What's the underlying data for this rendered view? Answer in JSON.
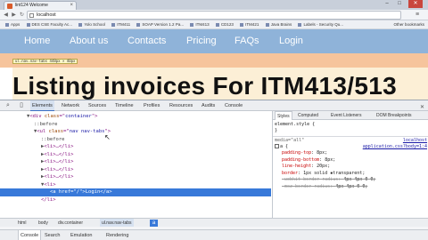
{
  "browser": {
    "tab_title": "lint124 Welcome",
    "tab_close": "×",
    "win_min": "–",
    "win_max": "□",
    "win_close": "✕",
    "back": "◀",
    "forward": "▶",
    "reload": "↻",
    "url": "localhost",
    "menu": "≡",
    "bookmarks": [
      "Apps",
      "DES CSE Faculty Ac...",
      "Yolo School",
      "ITM411",
      "SOAP Version 1.2 Pa...",
      "ITM413",
      "CD123",
      "ITM421",
      "Java Brains",
      "Labels - Security Qu..."
    ],
    "bookmarks_other": "Other bookmarks"
  },
  "site": {
    "nav": [
      "Home",
      "About us",
      "Contacts",
      "Pricing",
      "FAQs",
      "Login"
    ],
    "tooltip": "ul.nav.nav-tabs 448px × 40px",
    "heading": "Listing invoices For ITM413/513"
  },
  "devtools": {
    "tabs": [
      "Elements",
      "Network",
      "Sources",
      "Timeline",
      "Profiles",
      "Resources",
      "Audits",
      "Console"
    ],
    "close": "✕",
    "elements": [
      {
        "indent": 0,
        "tri": "▼",
        "parts": [
          "<div ",
          "class",
          "=\"",
          "container",
          "\">"
        ]
      },
      {
        "indent": 1,
        "tri": "",
        "pseudo": "::before"
      },
      {
        "indent": 1,
        "tri": "▼",
        "parts": [
          "<ul ",
          "class",
          "=\"",
          "nav nav-tabs",
          "\">"
        ]
      },
      {
        "indent": 2,
        "tri": "",
        "pseudo": "::before"
      },
      {
        "indent": 2,
        "tri": "▶",
        "tagtext": "<li>…</li>"
      },
      {
        "indent": 2,
        "tri": "▶",
        "tagtext": "<li>…</li>"
      },
      {
        "indent": 2,
        "tri": "▶",
        "tagtext": "<li>…</li>"
      },
      {
        "indent": 2,
        "tri": "▶",
        "tagtext": "<li>…</li>"
      },
      {
        "indent": 2,
        "tri": "▶",
        "tagtext": "<li>…</li>"
      },
      {
        "indent": 2,
        "tri": "▼",
        "tagtext": "<li>"
      },
      {
        "indent": 3,
        "tri": "",
        "selected": true,
        "tagtext": "<a href=\"/\">Login</a>"
      },
      {
        "indent": 2,
        "tri": "",
        "tagtext": "</li>"
      }
    ],
    "breadcrumbs": [
      "html",
      "body",
      "div.container",
      "ul.nav.nav-tabs"
    ],
    "breadcrumb_arrow": "a",
    "styles_tabs": [
      "Styles",
      "Computed",
      "Event Listeners",
      "DOM Breakpoints"
    ],
    "styles": {
      "element_style": "element.style {",
      "close_brace": "}",
      "media": "media=\"all\"",
      "source_host": "localhost",
      "source_file": "application.css?body=1:4",
      "selector": "a {",
      "props": [
        {
          "name": "padding-top",
          "value": "8px;",
          "strike": false
        },
        {
          "name": "padding-bottom",
          "value": "8px;",
          "strike": false
        },
        {
          "name": "line-height",
          "value": "20px;",
          "strike": false
        },
        {
          "name": "border",
          "value": "1px solid ▪transparent;",
          "strike": false
        },
        {
          "name": "-webkit-border-radius",
          "value": "4px 4px 0 0;",
          "strike": true
        },
        {
          "name": "-moz-border-radius",
          "value": "4px 4px 0 0;",
          "strike": true
        }
      ]
    },
    "bottom_tabs": [
      "Console",
      "Search",
      "Emulation",
      "Rendering"
    ]
  },
  "colors": {
    "navbar": "#8fb3d9",
    "orange_strip": "#f6c49c",
    "selection": "#3879d9"
  }
}
